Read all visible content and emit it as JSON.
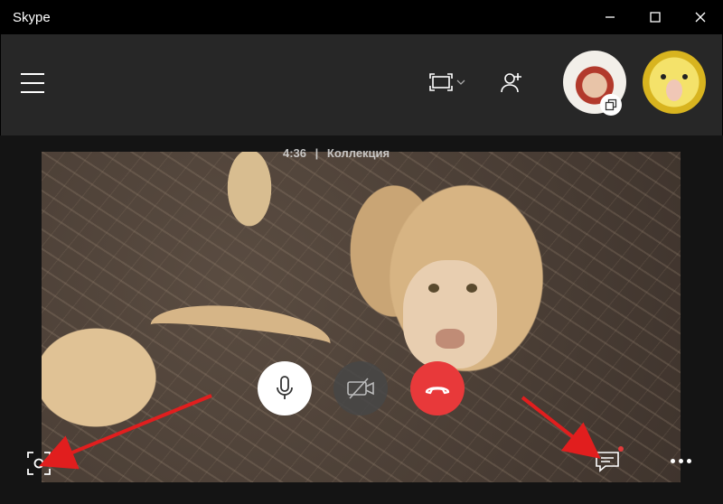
{
  "window": {
    "title": "Skype"
  },
  "call": {
    "duration": "4:36",
    "collection_label": "Коллекция"
  },
  "icons": {
    "menu": "hamburger-icon",
    "screen": "screen-share-icon",
    "add": "add-person-icon",
    "mic": "microphone-icon",
    "camera": "camera-off-icon",
    "hangup": "hang-up-icon",
    "snapshot": "snapshot-icon",
    "chat": "chat-icon",
    "more": "more-icon"
  },
  "colors": {
    "end_call": "#e8393a",
    "titlebar": "#000000",
    "header": "#272727",
    "arrow": "#e11e1e"
  }
}
